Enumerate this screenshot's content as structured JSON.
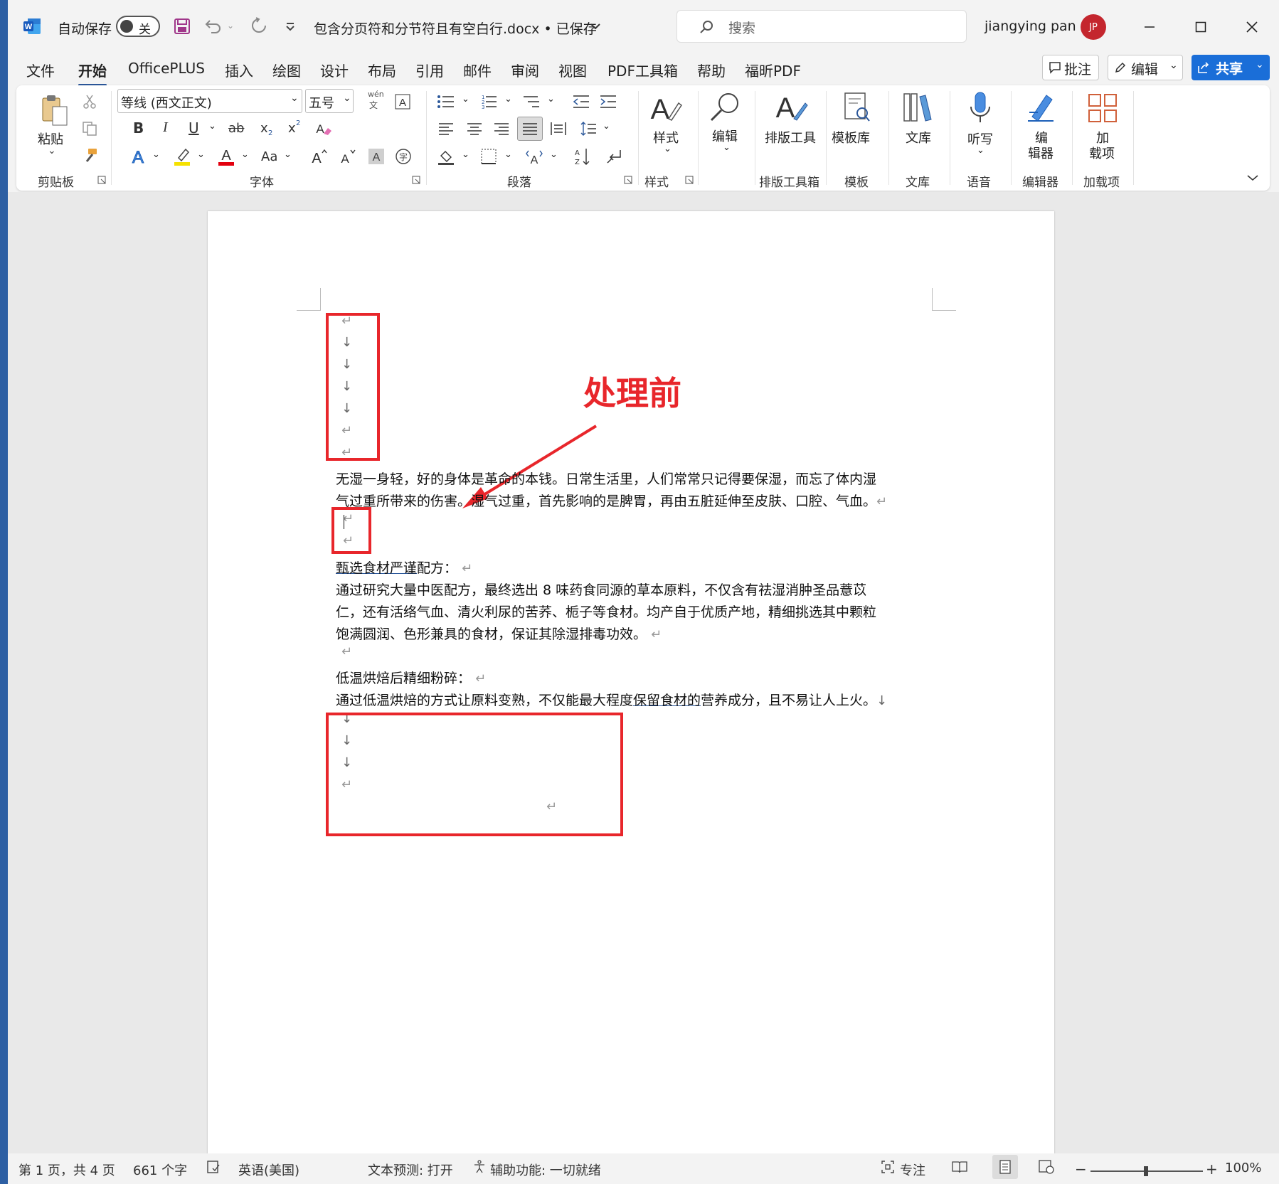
{
  "titlebar": {
    "autosave_label": "自动保存",
    "autosave_state": "关",
    "document_title": "包含分页符和分节符且有空白行.docx • 已保存",
    "search_placeholder": "搜索",
    "user_name": "jiangying pan",
    "user_initials": "JP"
  },
  "menu": {
    "items": [
      "文件",
      "开始",
      "OfficePLUS",
      "插入",
      "绘图",
      "设计",
      "布局",
      "引用",
      "邮件",
      "审阅",
      "视图",
      "PDF工具箱",
      "帮助",
      "福昕PDF"
    ],
    "active": "开始",
    "comment_label": "批注",
    "edit_label": "编辑",
    "share_label": "共享"
  },
  "ribbon": {
    "paste_label": "粘贴",
    "font_name": "等线 (西文正文)",
    "font_size": "五号",
    "phonetic_top": "wén",
    "phonetic_bottom": "文",
    "bold": "B",
    "italic": "I",
    "underline": "U",
    "strike": "ab",
    "subscript": "x",
    "superscript": "x",
    "change_case": "Aa",
    "styles_label": "样式",
    "editing_label": "编辑",
    "layout_tool_label": "排版工具",
    "template_lib_label": "模板库",
    "library_label": "文库",
    "dictate_label": "听写",
    "editor_label_1": "编",
    "editor_label_2": "辑器",
    "addins_label_1": "加",
    "addins_label_2": "载项",
    "groups": {
      "clipboard": "剪贴板",
      "font": "字体",
      "paragraph": "段落",
      "styles": "样式",
      "layout_toolbox": "排版工具箱",
      "templates": "模板",
      "library": "文库",
      "voice": "语音",
      "editor": "编辑器",
      "addins": "加载项"
    }
  },
  "document": {
    "annotation": "处理前",
    "para1_line1": "无湿一身轻，好的身体是革命的本钱。日常生活里，人们常常只记得要保湿，而忘了体内湿",
    "para1_line2": "气过重所带来的伤害。湿气过重，首先影响的是脾胃，再由五脏延伸至皮肤、口腔、气血。",
    "heading1_underlined": "甄选食材严谨",
    "heading1_rest": "配方：",
    "para2_line1": "通过研究大量中医配方，最终选出 8 味药食同源的草本原料，不仅含有祛湿消肿圣品薏苡",
    "para2_line2": "仁，还有活络气血、清火利尿的苦荞、栀子等食材。均产自于优质产地，精细挑选其中颗粒",
    "para2_line3": "饱满圆润、色形兼具的食材，保证其除湿排毒功效。",
    "heading2": "低温烘焙后精细粉碎：",
    "para3_a": "通过低温烘焙的方式让原料变熟，不仅能最大程度",
    "para3_underlined": "保留食材的",
    "para3_b": "营养成分，且不易让人上火。",
    "paragraph_mark": "↵",
    "line_break_mark": "↓"
  },
  "status": {
    "page": "第 1 页，共 4 页",
    "words": "661 个字",
    "language": "英语(美国)",
    "text_prediction": "文本预测: 打开",
    "accessibility": "辅助功能: 一切就绪",
    "focus": "专注",
    "zoom": "100%",
    "zoom_level": 1.0
  },
  "colors": {
    "accent": "#2b579a",
    "annotation_red": "#e8262b",
    "share_button": "#1a6ed8"
  }
}
